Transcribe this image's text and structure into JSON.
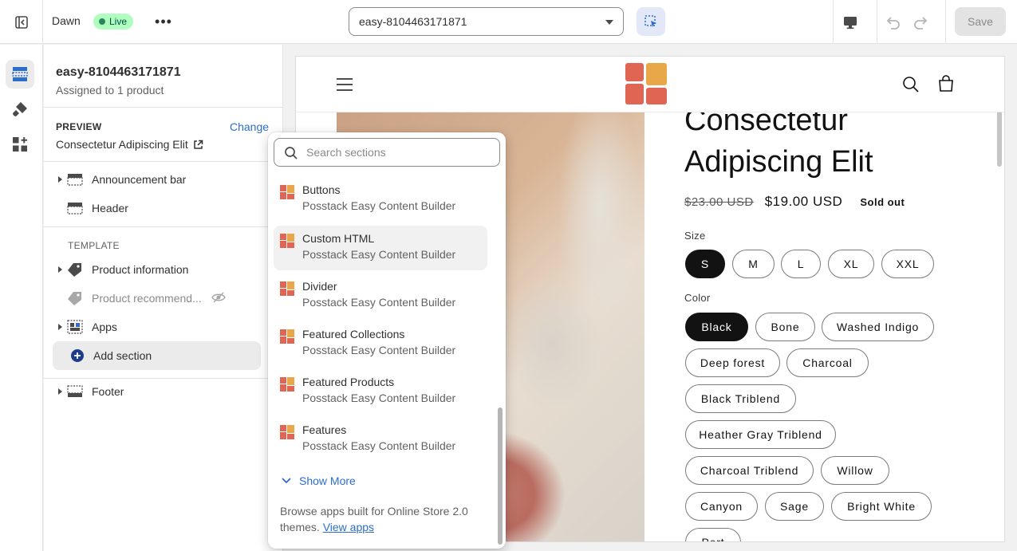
{
  "topbar": {
    "theme_name": "Dawn",
    "live_badge": "Live",
    "more_label": "•••",
    "template_select": "easy-8104463171871",
    "save_label": "Save",
    "icons": [
      "exit-icon",
      "more-icon",
      "inspector-icon",
      "desktop-icon",
      "undo-icon",
      "redo-icon"
    ]
  },
  "rail": {
    "items": [
      {
        "icon": "sections-icon",
        "active": true
      },
      {
        "icon": "theme-settings-icon",
        "active": false
      },
      {
        "icon": "app-embeds-icon",
        "active": false
      }
    ]
  },
  "panel": {
    "title": "easy-8104463171871",
    "subtitle": "Assigned to 1 product",
    "preview_label": "PREVIEW",
    "change_label": "Change",
    "preview_value": "Consectetur Adipiscing Elit",
    "template_label": "TEMPLATE",
    "items": [
      {
        "label": "Announcement bar",
        "icon": "section-icon"
      },
      {
        "label": "Header",
        "icon": "section-icon"
      },
      {
        "label": "Product information",
        "icon": "tag-icon"
      },
      {
        "label": "Product recommend...",
        "icon": "tag-icon"
      },
      {
        "label": "Apps",
        "icon": "apps-icon"
      },
      {
        "label": "Footer",
        "icon": "section-icon"
      }
    ],
    "add_section": "Add section"
  },
  "picker": {
    "search_placeholder": "Search sections",
    "items": [
      {
        "name": "Buttons",
        "vendor": "Posstack Easy Content Builder"
      },
      {
        "name": "Custom HTML",
        "vendor": "Posstack Easy Content Builder"
      },
      {
        "name": "Divider",
        "vendor": "Posstack Easy Content Builder"
      },
      {
        "name": "Featured Collections",
        "vendor": "Posstack Easy Content Builder"
      },
      {
        "name": "Featured Products",
        "vendor": "Posstack Easy Content Builder"
      },
      {
        "name": "Features",
        "vendor": "Posstack Easy Content Builder"
      }
    ],
    "show_more": "Show More",
    "browse_text": "Browse apps built for Online Store 2.0 themes.",
    "view_apps": "View apps"
  },
  "store": {
    "product_title": "Consectetur Adipiscing Elit",
    "price_old": "$23.00 USD",
    "price_new": "$19.00 USD",
    "sold_out": "Sold out",
    "size_label": "Size",
    "sizes": [
      "S",
      "M",
      "L",
      "XL",
      "XXL"
    ],
    "color_label": "Color",
    "colors": [
      "Black",
      "Bone",
      "Washed Indigo",
      "Deep forest",
      "Charcoal",
      "Black Triblend",
      "Heather Gray Triblend",
      "Charcoal Triblend",
      "Willow",
      "Canyon",
      "Sage",
      "Bright White",
      "Port"
    ],
    "selected_size": "S",
    "selected_color": "Black"
  },
  "colors": {
    "accent_blue": "#2c6ecb",
    "live_green": "#affebf",
    "logo_red": "#e06552",
    "logo_orange": "#e8a84a"
  }
}
